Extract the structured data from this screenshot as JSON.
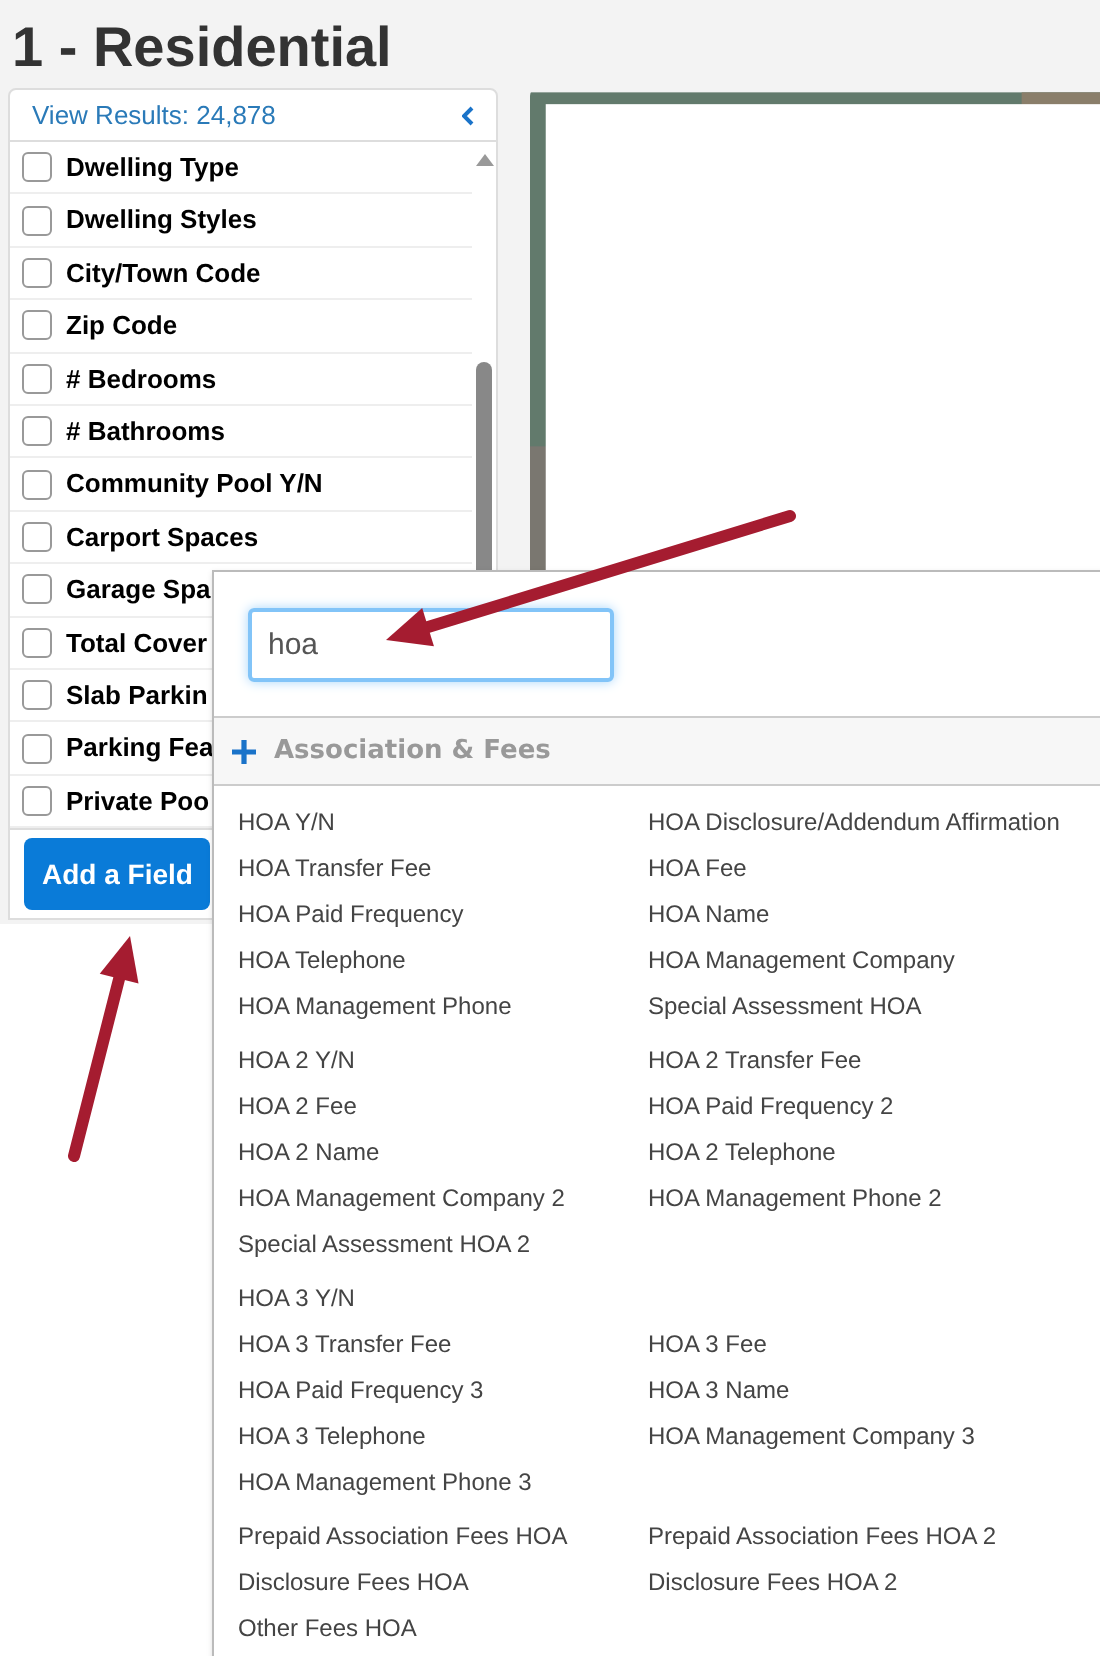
{
  "page_title": "1 - Residential",
  "sidebar": {
    "results_link": "View Results: 24,878",
    "items": [
      {
        "label": "Dwelling Type",
        "checked": false
      },
      {
        "label": "Dwelling Styles",
        "checked": false
      },
      {
        "label": "City/Town Code",
        "checked": false
      },
      {
        "label": "Zip Code",
        "checked": false
      },
      {
        "label": "# Bedrooms",
        "checked": false
      },
      {
        "label": "# Bathrooms",
        "checked": false
      },
      {
        "label": "Community Pool Y/N",
        "checked": false
      },
      {
        "label": "Carport Spaces",
        "checked": false
      },
      {
        "label": "Garage Spa",
        "checked": false
      },
      {
        "label": "Total Cover",
        "checked": false
      },
      {
        "label": "Slab Parkin",
        "checked": false
      },
      {
        "label": "Parking Fea",
        "checked": false
      },
      {
        "label": "Private Poo",
        "checked": false
      }
    ],
    "button": "Add a Field"
  },
  "field_picker": {
    "search": {
      "value": "hoa"
    },
    "category": {
      "label": "Association & Fees",
      "expanded": true
    },
    "groups": [
      [
        [
          "HOA Y/N",
          "HOA Disclosure/Addendum Affirmation"
        ],
        [
          "HOA Transfer Fee",
          "HOA Fee"
        ],
        [
          "HOA Paid Frequency",
          "HOA Name"
        ],
        [
          "HOA Telephone",
          "HOA Management Company"
        ],
        [
          "HOA Management Phone",
          "Special Assessment HOA"
        ]
      ],
      [
        [
          "HOA 2 Y/N",
          "HOA 2 Transfer Fee"
        ],
        [
          "HOA 2 Fee",
          "HOA Paid Frequency 2"
        ],
        [
          "HOA 2 Name",
          "HOA 2 Telephone"
        ],
        [
          "HOA Management Company 2",
          "HOA Management Phone 2"
        ],
        [
          "Special Assessment HOA 2"
        ]
      ],
      [
        [
          "HOA 3 Y/N"
        ],
        [
          "HOA 3 Transfer Fee",
          "HOA 3 Fee"
        ],
        [
          "HOA Paid Frequency 3",
          "HOA 3 Name"
        ],
        [
          "HOA 3 Telephone",
          "HOA Management Company 3"
        ],
        [
          "HOA Management Phone 3"
        ]
      ],
      [
        [
          "Prepaid Association Fees HOA",
          "Prepaid Association Fees HOA 2"
        ],
        [
          "Disclosure Fees HOA",
          "Disclosure Fees HOA 2"
        ],
        [
          "Other Fees HOA"
        ]
      ]
    ]
  }
}
